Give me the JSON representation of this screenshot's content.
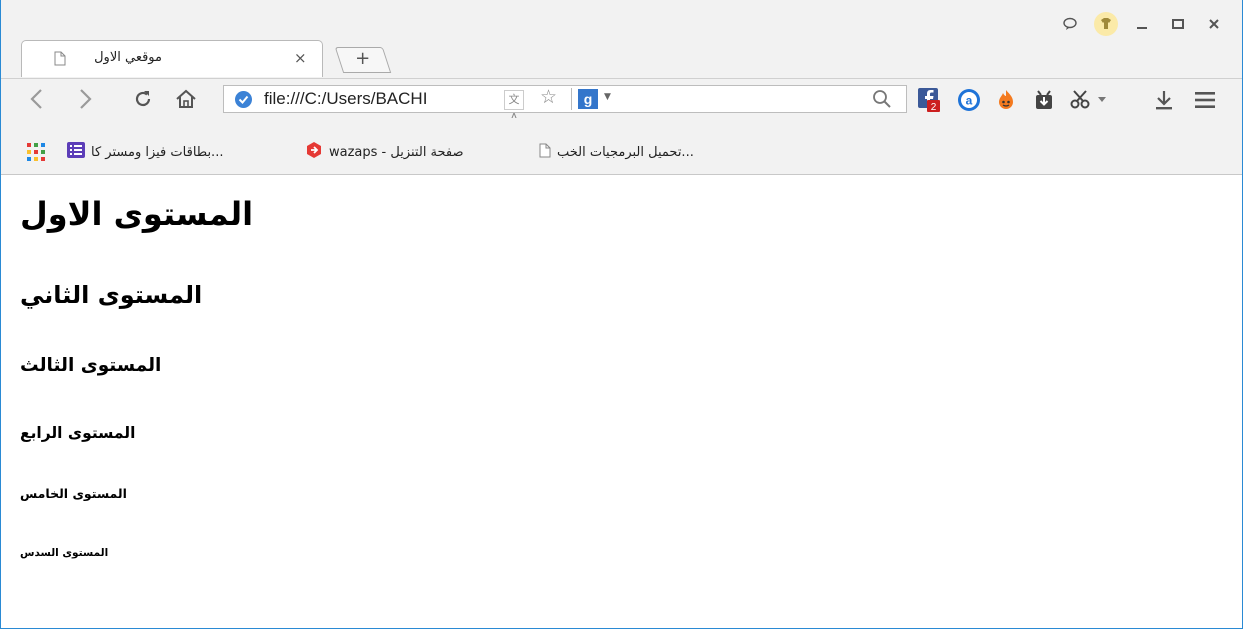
{
  "browser": {
    "tab_title": "موقعي الاول",
    "tab_close": "×",
    "new_tab": "+",
    "url": "file:///C:/Users/BACHI",
    "facebook_badge": "2",
    "colors": {
      "accent": "#2a8ad4",
      "secure": "#3b82d6",
      "facebook": "#3b5998",
      "badge": "#cc1f1f"
    }
  },
  "window_controls": {
    "icons": [
      "chat-icon",
      "extension-shirt-icon",
      "minimize-icon",
      "maximize-icon",
      "close-icon"
    ]
  },
  "bookmarks": {
    "apps_icon": "apps-grid-icon",
    "items": [
      {
        "label": "...بطاقات فيزا ومستر كا",
        "icon": "list-icon"
      },
      {
        "label": "wazaps - صفحة التنزيل",
        "icon": "wazaps-icon"
      },
      {
        "label": "...تحميل البرمجيات الخب",
        "icon": "page-icon"
      }
    ]
  },
  "page": {
    "h1": "المستوى الاول",
    "h2": "المستوى الثاني",
    "h3": "المستوى الثالث",
    "h4": "المستوى الرابع",
    "h5": "المستوى الخامس",
    "h6": "المستوى السدس"
  }
}
